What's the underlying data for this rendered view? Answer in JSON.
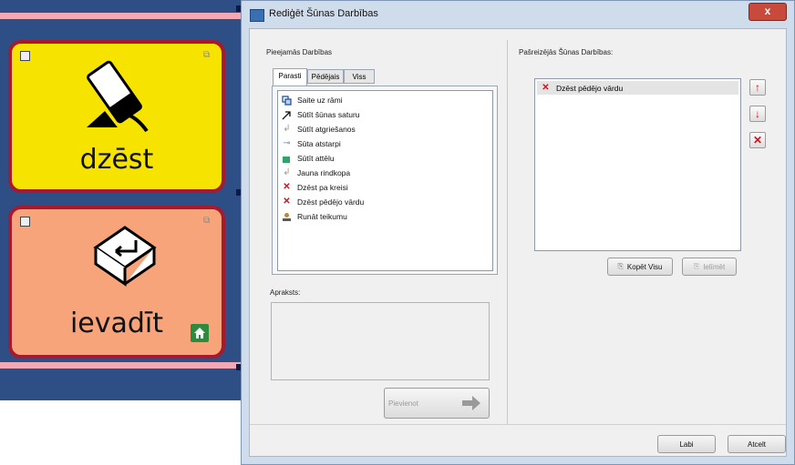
{
  "background_app": {
    "cells": [
      {
        "label": "dzēst",
        "icon": "eraser-icon"
      },
      {
        "label": "ievadīt",
        "icon": "enter-key-icon"
      }
    ],
    "colors": {
      "panel": "#2d4f86",
      "cell_yellow": "#f6e400",
      "cell_orange": "#f7a47b",
      "cell_border": "#a6192e"
    }
  },
  "dialog": {
    "title": "Rediģēt Šūnas Darbības",
    "close_label": "x",
    "left": {
      "group_label": "Pieejamās Darbības",
      "tabs": [
        "Parasti",
        "Pēdējais",
        "Viss"
      ],
      "active_tab": "Parasti",
      "actions": [
        {
          "label": "Saite uz rāmi",
          "icon": "link-frame-icon"
        },
        {
          "label": "Sūtīt šūnas saturu",
          "icon": "arrow-diagonal-icon"
        },
        {
          "label": "Sūtīt atgriešanos",
          "icon": "return-icon"
        },
        {
          "label": "Sūta atstarpi",
          "icon": "space-icon"
        },
        {
          "label": "Sūtīt attēlu",
          "icon": "image-icon"
        },
        {
          "label": "Jauna rindkopa",
          "icon": "paragraph-icon"
        },
        {
          "label": "Dzēst pa kreisi",
          "icon": "delete-left-icon"
        },
        {
          "label": "Dzēst pēdējo vārdu",
          "icon": "delete-word-icon"
        },
        {
          "label": "Runāt teikumu",
          "icon": "speak-icon"
        }
      ],
      "description_label": "Apraksts:",
      "add_button_label": "Pievienot"
    },
    "right": {
      "group_label": "Pašreizējās Šūnas Darbības:",
      "current_actions": [
        {
          "label": "Dzēst pēdējo vārdu",
          "icon": "delete-word-icon"
        }
      ],
      "copy_all_label": "Kopēt Visu",
      "paste_label": "Ielīmēt"
    },
    "ok_label": "Labi",
    "cancel_label": "Atcelt"
  }
}
